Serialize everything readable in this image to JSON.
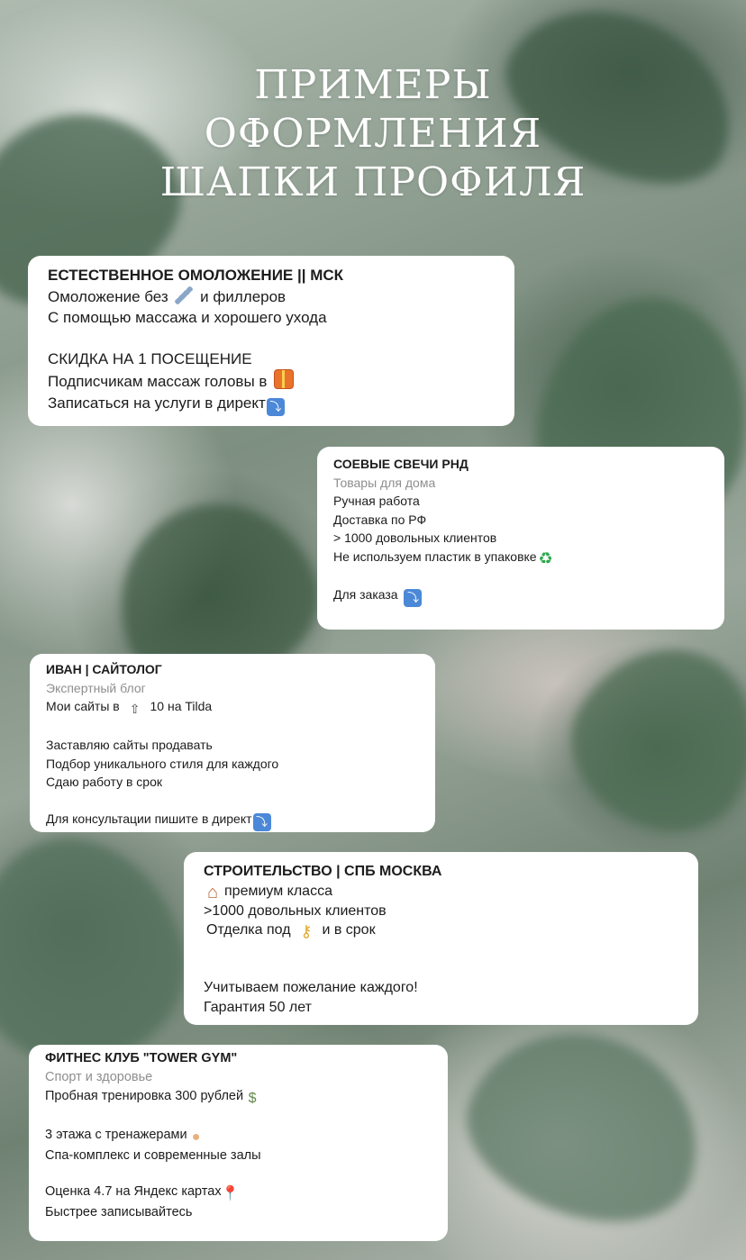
{
  "title_lines": [
    "ПРИМЕРЫ",
    "ОФОРМЛЕНИЯ",
    "ШАПКИ ПРОФИЛЯ"
  ],
  "cards": [
    {
      "name": "ЕСТЕСТВЕННОЕ ОМОЛОЖЕНИЕ || МСК",
      "lines": [
        {
          "text": "Омоложение без",
          "icon": "syringe-icon",
          "after": "и филлеров"
        },
        {
          "text": "С помощью массажа и хорошего ухода"
        },
        {
          "text": "СКИДКА НА 1 ПОСЕЩЕНИЕ"
        },
        {
          "text": "Подписчикам массаж головы в",
          "icon": "gift-icon"
        },
        {
          "text": "Записаться на услуги в директ",
          "icon": "arrow-down-icon"
        }
      ]
    },
    {
      "name": "СОЕВЫЕ СВЕЧИ РНД",
      "category": "Товары для дома",
      "lines": [
        {
          "text": "Ручная работа"
        },
        {
          "text": "Доставка по РФ"
        },
        {
          "text": "> 1000 довольных клиентов"
        },
        {
          "text": "Не используем пластик в упаковке",
          "icon": "recycle-icon"
        },
        {
          "text": "Для заказа",
          "icon": "arrow-down-icon"
        }
      ]
    },
    {
      "name": "ИВАН | САЙТОЛОГ",
      "category": "Экспертный блог",
      "lines": [
        {
          "text": "Мои сайты в",
          "icon": "top-icon",
          "after": "10 на Tilda"
        },
        {
          "text": "Заставляю сайты продавать"
        },
        {
          "text": "Подбор уникального стиля для каждого"
        },
        {
          "text": "Сдаю работу в срок"
        },
        {
          "text": "Для консультации пишите в директ",
          "icon": "arrow-down-icon"
        }
      ]
    },
    {
      "name": "СТРОИТЕЛЬСТВО | СПБ МОСКВА",
      "lines": [
        {
          "icon": "house-icon",
          "text": "премиум класса"
        },
        {
          "text": ">1000 довольных клиентов"
        },
        {
          "text": "Отделка под",
          "icon": "key-icon",
          "after": "и в срок"
        },
        {
          "text": "Учитываем пожелание каждого!"
        },
        {
          "text": "Гарантия 50 лет"
        }
      ]
    },
    {
      "name": "ФИТНЕС КЛУБ \"TOWER GYM\"",
      "category": "Спорт и здоровье",
      "lines": [
        {
          "text": "Пробная тренировка 300 рублей",
          "icon": "money-icon"
        },
        {
          "text": "3 этажа с тренажерами",
          "icon": "muscle-icon"
        },
        {
          "text": "Спа-комплекс и современные залы"
        },
        {
          "text": "Оценка 4.7 на Яндекс картах",
          "icon": "pin-icon"
        },
        {
          "text": "Быстрее записывайтесь"
        }
      ]
    }
  ]
}
